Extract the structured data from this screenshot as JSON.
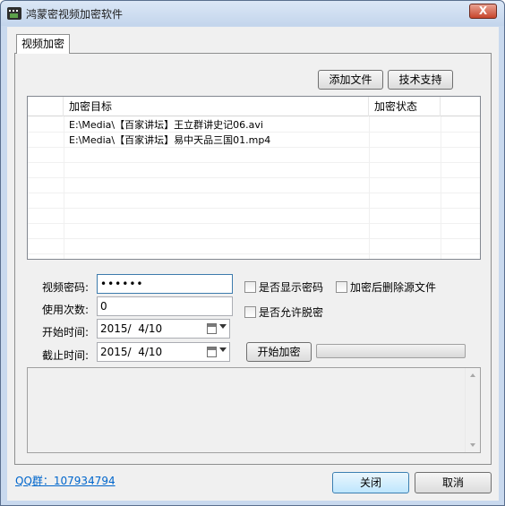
{
  "window": {
    "title": "鸿蒙密视频加密软件",
    "close_glyph": "X"
  },
  "tabs": [
    {
      "label": "视频加密",
      "selected": true
    }
  ],
  "toolbar": {
    "add_file_label": "添加文件",
    "tech_support_label": "技术支持"
  },
  "file_list": {
    "columns": [
      "",
      "加密目标",
      "加密状态",
      ""
    ],
    "rows": [
      {
        "target": "E:\\Media\\【百家讲坛】王立群讲史记06.avi",
        "status": ""
      },
      {
        "target": "E:\\Media\\【百家讲坛】易中天品三国01.mp4",
        "status": ""
      }
    ]
  },
  "form": {
    "password_label": "视频密码:",
    "password_value": "••••••",
    "uses_label": "使用次数:",
    "uses_value": "0",
    "start_label": "开始时间:",
    "start_value": "2015/  4/10",
    "end_label": "截止时间:",
    "end_value": "2015/  4/10",
    "show_password_label": "是否显示密码",
    "show_password_checked": false,
    "delete_source_label": "加密后删除源文件",
    "delete_source_checked": false,
    "allow_decrypt_label": "是否允许脱密",
    "allow_decrypt_checked": false,
    "start_encrypt_label": "开始加密",
    "progress": 0
  },
  "footer": {
    "qq_link": "QQ群：107934794",
    "close_label": "关闭",
    "cancel_label": "取消"
  },
  "colors": {
    "titlebar": "#c3d5ec",
    "link": "#0066cc",
    "close_button": "#c7452c"
  }
}
